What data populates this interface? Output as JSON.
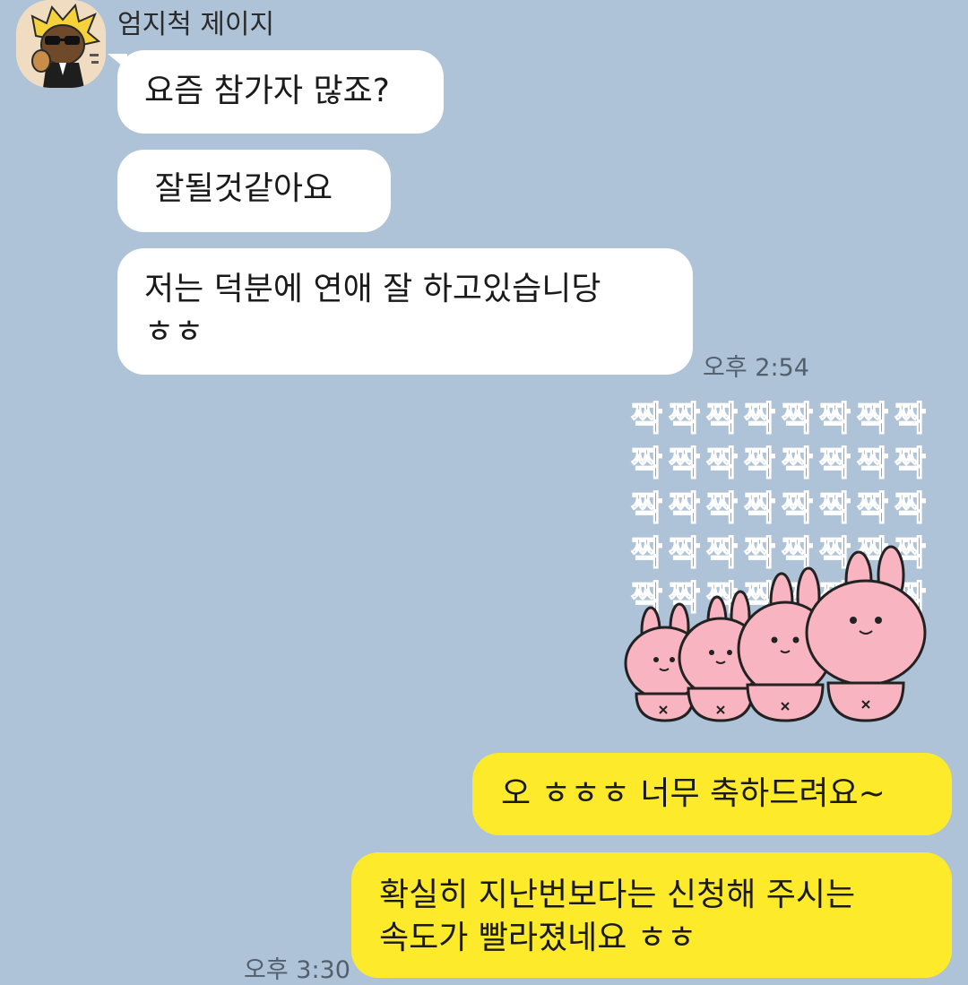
{
  "chat": {
    "sender_name": "엄지척 제이지",
    "messages": [
      {
        "side": "incoming",
        "text": "요즘 참가자 많죠?"
      },
      {
        "side": "incoming",
        "text": " 잘될것같아요"
      },
      {
        "side": "incoming",
        "lines": [
          "저는 덕분에 연애 잘 하고있습니당",
          "ㅎㅎ"
        ],
        "time": "오후 2:54"
      },
      {
        "side": "outgoing",
        "type": "sticker",
        "sticker_text": "짝",
        "sticker_icon": "clapping-bunnies-sticker"
      },
      {
        "side": "outgoing",
        "text": "오 ㅎㅎㅎ 너무 축하드려요~"
      },
      {
        "side": "outgoing",
        "lines": [
          "확실히 지난번보다는 신청해 주시는",
          "속도가 빨라졌네요 ㅎㅎ"
        ],
        "time": "오후 3:30"
      }
    ]
  },
  "colors": {
    "background": "#aec2d8",
    "incoming_bubble": "#ffffff",
    "outgoing_bubble": "#fdeb2b",
    "bunny_pink": "#f8b4c0"
  }
}
